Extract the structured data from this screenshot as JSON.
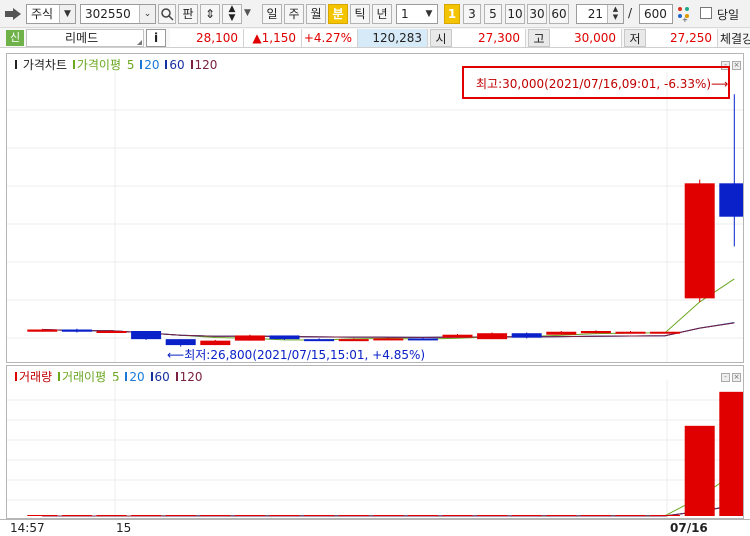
{
  "toolbar": {
    "market_type": "주식",
    "stock_code": "302550",
    "search_label": "판",
    "periods": [
      "일",
      "주",
      "월",
      "분",
      "틱",
      "년"
    ],
    "active_period": "분",
    "interval_value": "1",
    "minute_options": [
      "1",
      "3",
      "5",
      "10",
      "30",
      "60"
    ],
    "count_value": "21",
    "total_value": "600",
    "slash": "/",
    "today_label": "당일"
  },
  "quote": {
    "prefix_tag": "신",
    "stock_name": "리메드",
    "info_label": "i",
    "price": "28,100",
    "change": "▲1,150",
    "change_pct": "+4.27%",
    "volume": "120,283",
    "open_label": "시",
    "open": "27,300",
    "high_label": "고",
    "high": "30,000",
    "low_label": "저",
    "low": "27,250",
    "strength_label": "체결강"
  },
  "price_pane": {
    "legend": {
      "title": "가격차트",
      "ma_label": "가격이평",
      "ma_periods": [
        "5",
        "20",
        "60",
        "120"
      ]
    },
    "high_annotation": "최고:30,000(2021/07/16,09:01, -6.33%)⟶",
    "low_annotation": "⟵최저:26,800(2021/07/15,15:01, +4.85%)"
  },
  "volume_pane": {
    "legend": {
      "title": "거래량",
      "ma_label": "거래이평",
      "ma_periods": [
        "5",
        "20",
        "60",
        "120"
      ]
    }
  },
  "x_axis": {
    "labels": [
      "14:57",
      "15",
      "07/16"
    ]
  },
  "colors": {
    "up": "#e00000",
    "down": "#0a20c8",
    "ma5": "#6aa820",
    "ma20": "#1a78d8",
    "ma60": "#1530a0",
    "ma120": "#7a2040",
    "highlight_box": "#e00000"
  },
  "chart_data": {
    "type": "candlestick",
    "x_labels": [
      "14:57",
      "15",
      "07/16"
    ],
    "candles": [
      {
        "open": 26800,
        "close": 26830,
        "high": 26840,
        "low": 26800
      },
      {
        "open": 26830,
        "close": 26800,
        "high": 26840,
        "low": 26790
      },
      {
        "open": 26800,
        "close": 26810,
        "high": 26820,
        "low": 26800
      },
      {
        "open": 26810,
        "close": 26700,
        "high": 26810,
        "low": 26690
      },
      {
        "open": 26700,
        "close": 26620,
        "high": 26700,
        "low": 26600
      },
      {
        "open": 26620,
        "close": 26680,
        "high": 26690,
        "low": 26620
      },
      {
        "open": 26680,
        "close": 26750,
        "high": 26760,
        "low": 26680
      },
      {
        "open": 26750,
        "close": 26700,
        "high": 26750,
        "low": 26690
      },
      {
        "open": 26700,
        "close": 26690,
        "high": 26710,
        "low": 26680
      },
      {
        "open": 26690,
        "close": 26700,
        "high": 26710,
        "low": 26680
      },
      {
        "open": 26700,
        "close": 26710,
        "high": 26720,
        "low": 26700
      },
      {
        "open": 26710,
        "close": 26700,
        "high": 26720,
        "low": 26700
      },
      {
        "open": 26720,
        "close": 26760,
        "high": 26770,
        "low": 26720
      },
      {
        "open": 26700,
        "close": 26780,
        "high": 26790,
        "low": 26700
      },
      {
        "open": 26780,
        "close": 26720,
        "high": 26790,
        "low": 26710
      },
      {
        "open": 26760,
        "close": 26800,
        "high": 26810,
        "low": 26760
      },
      {
        "open": 26780,
        "close": 26810,
        "high": 26820,
        "low": 26780
      },
      {
        "open": 26800,
        "close": 26800,
        "high": 26810,
        "low": 26790
      },
      {
        "open": 26800,
        "close": 26800,
        "high": 26800,
        "low": 26800
      },
      {
        "open": 27250,
        "close": 28800,
        "high": 28850,
        "low": 27200
      },
      {
        "open": 28800,
        "close": 28350,
        "high": 30000,
        "low": 27950
      }
    ],
    "volumes": [
      0,
      0,
      0,
      0,
      300,
      150,
      150,
      150,
      150,
      0,
      0,
      0,
      0,
      0,
      300,
      0,
      0,
      400,
      500,
      61000,
      84000
    ],
    "price_range": [
      26500,
      30300
    ],
    "volume_range": [
      0,
      92000
    ],
    "highest": {
      "value": 30000,
      "time": "2021/07/16,09:01",
      "pct": "-6.33%"
    },
    "lowest": {
      "value": 26800,
      "time": "2021/07/15,15:01",
      "pct": "+4.85%"
    }
  }
}
